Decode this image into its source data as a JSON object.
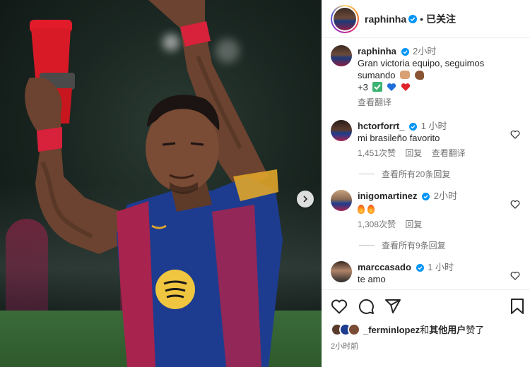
{
  "header": {
    "username": "raphinha",
    "follow_status": "已关注"
  },
  "caption": {
    "username": "raphinha",
    "time": "2小时",
    "text": "Gran victoria equipo, seguimos sumando",
    "extra": "+3",
    "translate": "查看翻译"
  },
  "comments": [
    {
      "username": "hctorforrt_",
      "time": "1 小时",
      "text": "mi brasileño favorito",
      "likes": "1,451次赞",
      "reply": "回复",
      "translate": "查看翻译",
      "view_replies": "查看所有20条回复"
    },
    {
      "username": "inigomartinez",
      "time": "2小时",
      "text": "",
      "likes": "1,308次赞",
      "reply": "回复",
      "view_replies": "查看所有9条回复"
    },
    {
      "username": "marccasado",
      "time": "1 小时",
      "text": "te amo"
    }
  ],
  "likes_summary": {
    "user": "_ferminlopez",
    "connector": "和",
    "others": "其他用户",
    "suffix": "赞了"
  },
  "post_time": "2小时前",
  "icons": {
    "verified": "verified-badge-icon",
    "carousel_next": "chevron-right-icon",
    "like": "heart-icon",
    "comment": "comment-icon",
    "share": "share-icon",
    "save": "bookmark-icon"
  },
  "colors": {
    "verified": "#0095f6",
    "text": "#262626",
    "muted": "#737373",
    "barca_blue": "#1d3c8f",
    "barca_red": "#a8234d"
  }
}
